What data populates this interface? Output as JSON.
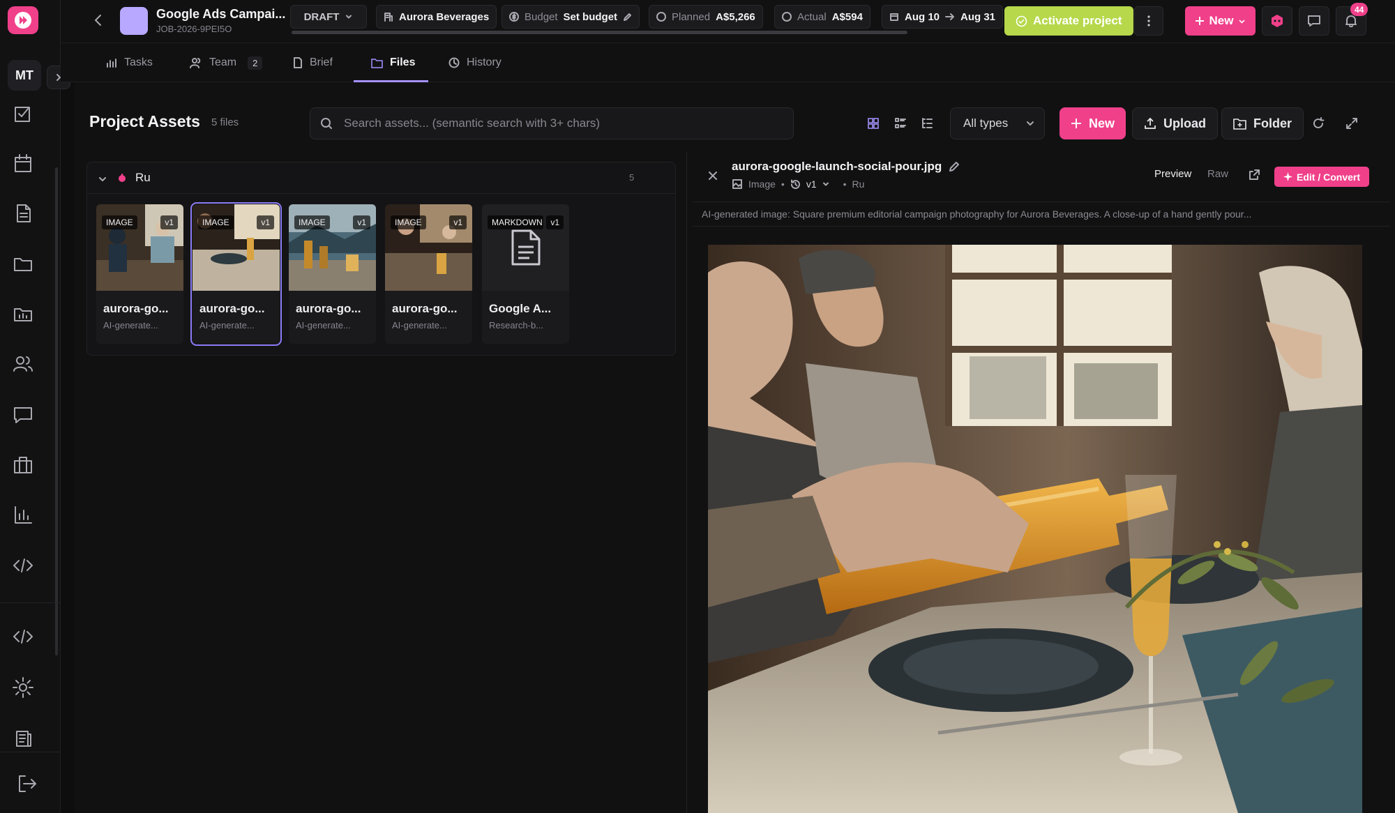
{
  "project": {
    "title": "Google Ads Campai...",
    "job_id": "JOB-2026-9PEI5O",
    "status": "DRAFT",
    "client": "Aurora Beverages",
    "budget_label": "Budget",
    "budget_action": "Set budget",
    "planned_label": "Planned",
    "planned_value": "A$5,266",
    "actual_label": "Actual",
    "actual_value": "A$594",
    "date_start": "Aug 10",
    "date_end": "Aug 31"
  },
  "header": {
    "activate_label": "Activate project",
    "new_label": "New",
    "notification_count": "44"
  },
  "user": {
    "initials": "MT"
  },
  "tabs": [
    {
      "label": "Tasks"
    },
    {
      "label": "Team",
      "count": "2"
    },
    {
      "label": "Brief"
    },
    {
      "label": "Files",
      "active": true
    },
    {
      "label": "History"
    }
  ],
  "assets": {
    "title": "Project Assets",
    "count_label": "5 files",
    "search_placeholder": "Search assets... (semantic search with 3+ chars)",
    "type_filter": "All types",
    "new_label": "New",
    "upload_label": "Upload",
    "folder_label": "Folder"
  },
  "folder": {
    "name": "Ru",
    "count": "5",
    "files": [
      {
        "type": "IMAGE",
        "version": "v1",
        "name": "aurora-go...",
        "sub": "AI-generate..."
      },
      {
        "type": "IMAGE",
        "version": "v1",
        "name": "aurora-go...",
        "sub": "AI-generate...",
        "selected": true
      },
      {
        "type": "IMAGE",
        "version": "v1",
        "name": "aurora-go...",
        "sub": "AI-generate..."
      },
      {
        "type": "IMAGE",
        "version": "v1",
        "name": "aurora-go...",
        "sub": "AI-generate..."
      },
      {
        "type": "MARKDOWN",
        "version": "v1",
        "name": "Google A...",
        "sub": "Research-b..."
      }
    ]
  },
  "preview": {
    "file_name": "aurora-google-launch-social-pour.jpg",
    "kind": "Image",
    "version": "v1",
    "folder": "Ru",
    "preview_tab": "Preview",
    "raw_tab": "Raw",
    "edit_label": "Edit / Convert",
    "description": "AI-generated image: Square premium editorial campaign photography for Aurora Beverages. A close-up of a hand gently pour..."
  },
  "colors": {
    "accent_pink": "#f0408a",
    "activate_green": "#b6d84a",
    "selection_purple": "#8b7cf6",
    "tab_underline": "#a592ff"
  }
}
